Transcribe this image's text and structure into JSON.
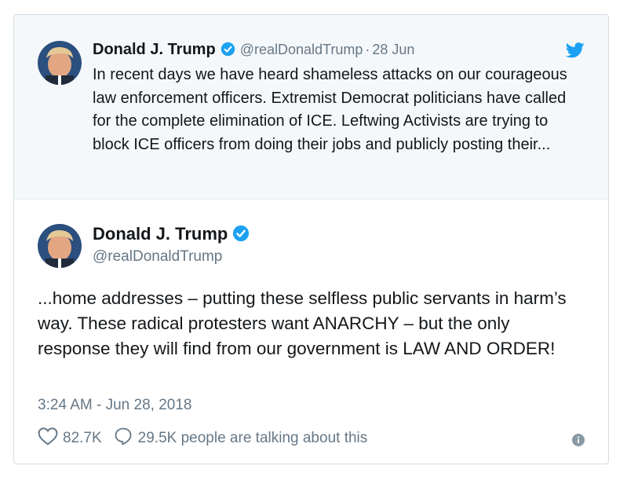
{
  "quoted_tweet": {
    "author_name": "Donald J. Trump",
    "handle": "@realDonaldTrump",
    "separator": "·",
    "date": "28 Jun",
    "text": "In recent days we have heard shameless attacks on our courageous law enforcement officers. Extremist Democrat politicians have called for the complete elimination of ICE. Leftwing Activists are trying to block ICE officers from doing their jobs and publicly posting their..."
  },
  "tweet": {
    "author_name": "Donald J. Trump",
    "handle": "@realDonaldTrump",
    "text": "...home addresses – putting these selfless public servants in harm’s way. These radical protesters want ANARCHY – but the only response they will find from our government is LAW AND ORDER!",
    "timestamp": "3:24 AM - Jun 28, 2018",
    "likes": "82.7K",
    "talking": "29.5K people are talking about this"
  },
  "icons": {
    "verified": "verified-badge-icon",
    "brand": "twitter-bird-icon",
    "like": "heart-icon",
    "reply": "speech-bubble-icon",
    "info": "info-icon"
  },
  "colors": {
    "accent": "#1da1f2",
    "muted": "#657786",
    "quoted_background": "#f5f8fa"
  }
}
